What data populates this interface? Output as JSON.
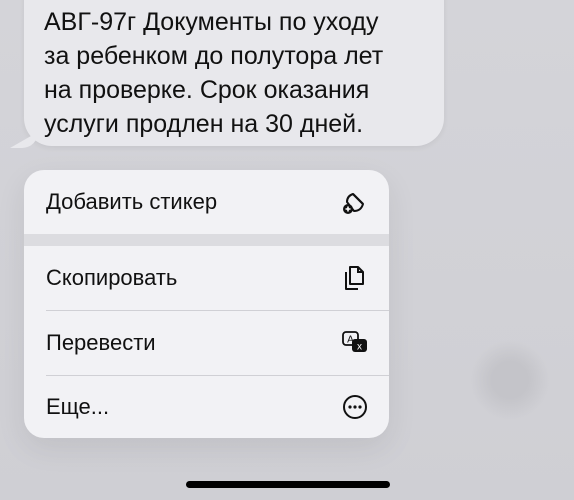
{
  "message": {
    "text": "АВГ-97г Документы по уходу\nза ребенком до полутора лет\nна проверке. Срок оказания\nуслуги продлен на 30 дней."
  },
  "context_menu": {
    "items": [
      {
        "label": "Добавить стикер",
        "icon": "sticker-icon"
      },
      {
        "label": "Скопировать",
        "icon": "copy-icon"
      },
      {
        "label": "Перевести",
        "icon": "translate-icon"
      },
      {
        "label": "Еще...",
        "icon": "more-icon"
      }
    ]
  },
  "colors": {
    "background": "#cfcfd4",
    "bubble": "#e8e8ec",
    "menu": "#f2f2f5",
    "text": "#111111"
  }
}
